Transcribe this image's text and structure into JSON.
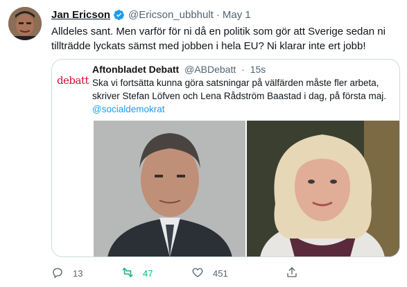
{
  "author": {
    "name": "Jan Ericson",
    "handle": "@Ericson_ubbhult",
    "separator": "·",
    "time": "May 1"
  },
  "tweet_text": "Alldeles sant. Men varför för ni då en politik som gör att Sverige sedan ni tillträdde lyckats sämst med jobben i hela EU? Ni klarar inte ert jobb!",
  "quote": {
    "avatar_text": "debatt",
    "name": "Aftonbladet Debatt",
    "handle": "@ABDebatt",
    "separator": "·",
    "time": "15s",
    "text": "Ska vi fortsätta kunna göra satsningar på välfärden måste fler arbeta, skriver Stefan Löfven och Lena Rådström Baastad i dag, på första maj.",
    "mention": "@socialdemokrat"
  },
  "actions": {
    "replies": "13",
    "retweets": "47",
    "likes": "451"
  },
  "colors": {
    "accent": "#1d9bf0",
    "retweet": "#00ba7c",
    "muted": "#536471",
    "brand_debatt": "#c8102e"
  },
  "icons": [
    "verified-badge-icon",
    "reply-icon",
    "retweet-icon",
    "like-icon",
    "share-icon"
  ]
}
